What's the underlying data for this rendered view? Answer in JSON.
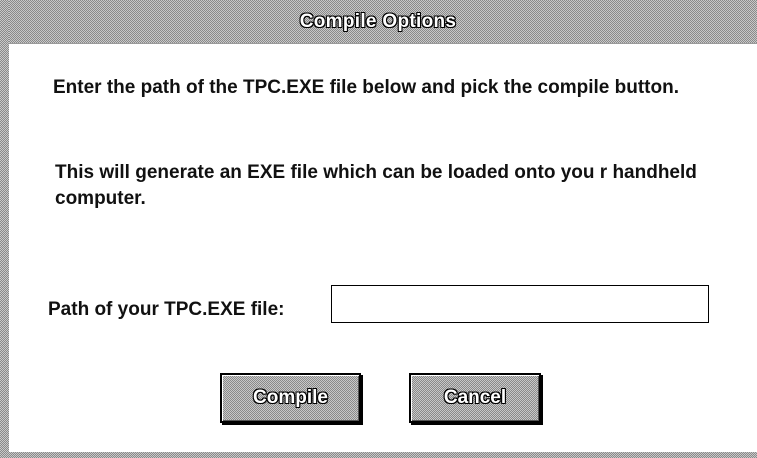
{
  "dialog": {
    "title": "Compile Options",
    "instruction_1": "Enter the path of the TPC.EXE file below and pick the compile button.",
    "instruction_2": "This will generate an EXE file which can be loaded onto you r handheld computer.",
    "path_label": "Path of your TPC.EXE file:",
    "path_value": "",
    "compile_label": "Compile",
    "cancel_label": "Cancel"
  },
  "colors": {
    "frame_light": "#c8c8c8",
    "frame_dark": "#8a8a8a",
    "background": "#ffffff",
    "text": "#111111"
  }
}
